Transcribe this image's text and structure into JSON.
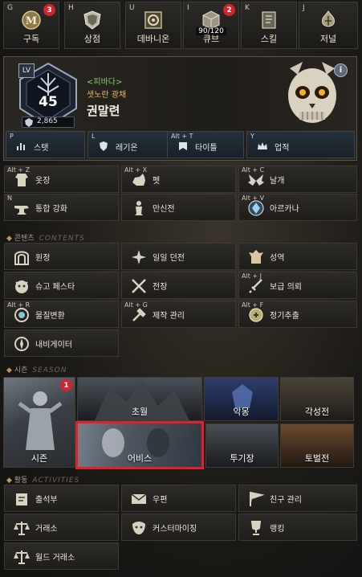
{
  "top_bar": [
    {
      "key": "G",
      "label": "구독",
      "badge": "3"
    },
    {
      "key": "H",
      "label": "상점"
    },
    {
      "key": "U",
      "label": "데바니온"
    },
    {
      "key": "I",
      "label": "큐브",
      "badge": "2",
      "count": "90/120"
    },
    {
      "key": "K",
      "label": "스킬"
    },
    {
      "key": "J",
      "label": "저널"
    }
  ],
  "profile": {
    "level_tag": "LV",
    "level": "45",
    "power": "2,865",
    "faction": "<피바다>",
    "title": "샛노란 광채",
    "name": "권말련",
    "info": "i"
  },
  "stat_bar": [
    {
      "key": "P",
      "label": "스탯"
    },
    {
      "key": "L",
      "label": "레기온"
    },
    {
      "key": "Alt + T",
      "label": "타이틀"
    },
    {
      "key": "Y",
      "label": "업적"
    }
  ],
  "menu_top": [
    {
      "key": "Alt + Z",
      "label": "옷장"
    },
    {
      "key": "Alt + X",
      "label": "펫"
    },
    {
      "key": "Alt + C",
      "label": "날개"
    },
    {
      "key": "N",
      "label": "통합 강화"
    },
    {
      "key": "",
      "label": "만신전"
    },
    {
      "key": "Alt + V",
      "label": "아르카나"
    }
  ],
  "content_section": {
    "title": "콘텐츠",
    "deco": "CONTENTS"
  },
  "menu_content": [
    {
      "key": "",
      "label": "원정"
    },
    {
      "key": "",
      "label": "일일 던전"
    },
    {
      "key": "",
      "label": "성역"
    },
    {
      "key": "",
      "label": "슈고 페스타"
    },
    {
      "key": "",
      "label": "전장"
    },
    {
      "key": "Alt + J",
      "label": "보급 의뢰"
    },
    {
      "key": "Alt + R",
      "label": "물질변환"
    },
    {
      "key": "Alt + G",
      "label": "제작 관리"
    },
    {
      "key": "Alt + F",
      "label": "정기추출"
    },
    {
      "key": "",
      "label": "내비게이터"
    }
  ],
  "season_section": {
    "title": "시즌",
    "deco": "SEASON"
  },
  "season_tiles": {
    "season": {
      "label": "시즌",
      "badge": "1"
    },
    "conquest": {
      "label": "초월"
    },
    "nightmare": {
      "label": "악몽"
    },
    "awakening": {
      "label": "각성전"
    },
    "abyss": {
      "label": "어비스"
    },
    "arena": {
      "label": "투기장"
    },
    "subjugation": {
      "label": "토벌전"
    }
  },
  "activity_section": {
    "title": "활동",
    "deco": "ACTIVITIES"
  },
  "menu_activity": [
    {
      "label": "출석부"
    },
    {
      "label": "우편"
    },
    {
      "label": "친구 관리"
    },
    {
      "label": "거래소"
    },
    {
      "label": "커스터마이징"
    },
    {
      "label": "랭킹"
    },
    {
      "label": "월드 거래소"
    }
  ],
  "colors": {
    "badge": "#d3242c",
    "highlight": "#e0202a",
    "faction": "#7fd060",
    "title": "#e8b86a"
  }
}
